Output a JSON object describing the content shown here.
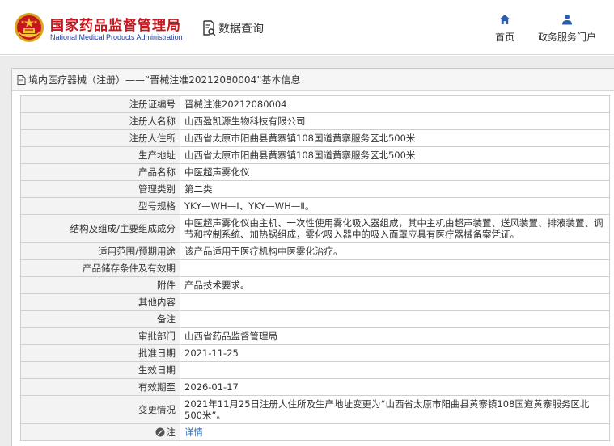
{
  "header": {
    "brand_cn": "国家药品监督管理局",
    "brand_en": "National Medical Products Administration",
    "query_label": "数据查询",
    "nav": [
      {
        "label": "首页",
        "icon": "home-icon"
      },
      {
        "label": "政务服务门户",
        "icon": "user-icon"
      }
    ]
  },
  "panel": {
    "title": "境内医疗器械（注册）——“晋械注准20212080004”基本信息"
  },
  "rows": [
    {
      "label": "注册证编号",
      "value": "晋械注准20212080004"
    },
    {
      "label": "注册人名称",
      "value": "山西盈凯源生物科技有限公司"
    },
    {
      "label": "注册人住所",
      "value": "山西省太原市阳曲县黄寨镇108国道黄寨服务区北500米"
    },
    {
      "label": "生产地址",
      "value": "山西省太原市阳曲县黄寨镇108国道黄寨服务区北500米"
    },
    {
      "label": "产品名称",
      "value": "中医超声雾化仪"
    },
    {
      "label": "管理类别",
      "value": "第二类"
    },
    {
      "label": "型号规格",
      "value": "YKY—WH—Ⅰ、YKY—WH—Ⅱ。"
    },
    {
      "label": "结构及组成/主要组成成分",
      "value": "中医超声雾化仪由主机、一次性使用雾化吸入器组成，其中主机由超声装置、送风装置、排液装置、调节和控制系统、加热锅组成，雾化吸入器中的吸入面罩应具有医疗器械备案凭证。"
    },
    {
      "label": "适用范围/预期用途",
      "value": "该产品适用于医疗机构中医雾化治疗。"
    },
    {
      "label": "产品储存条件及有效期",
      "value": ""
    },
    {
      "label": "附件",
      "value": "产品技术要求。"
    },
    {
      "label": "其他内容",
      "value": ""
    },
    {
      "label": "备注",
      "value": ""
    },
    {
      "label": "审批部门",
      "value": "山西省药品监督管理局"
    },
    {
      "label": "批准日期",
      "value": "2021-11-25"
    },
    {
      "label": "生效日期",
      "value": ""
    },
    {
      "label": "有效期至",
      "value": "2026-01-17"
    },
    {
      "label": "变更情况",
      "value": "2021年11月25日注册人住所及生产地址变更为“山西省太原市阳曲县黄寨镇108国道黄寨服务区北500米”。"
    },
    {
      "label": "注",
      "value": "详情",
      "icon": "note-icon"
    }
  ],
  "colors": {
    "brand_red": "#c4161c",
    "brand_blue": "#1f3a93",
    "link": "#2a6ebb",
    "nav_icon": "#2a5db0"
  }
}
